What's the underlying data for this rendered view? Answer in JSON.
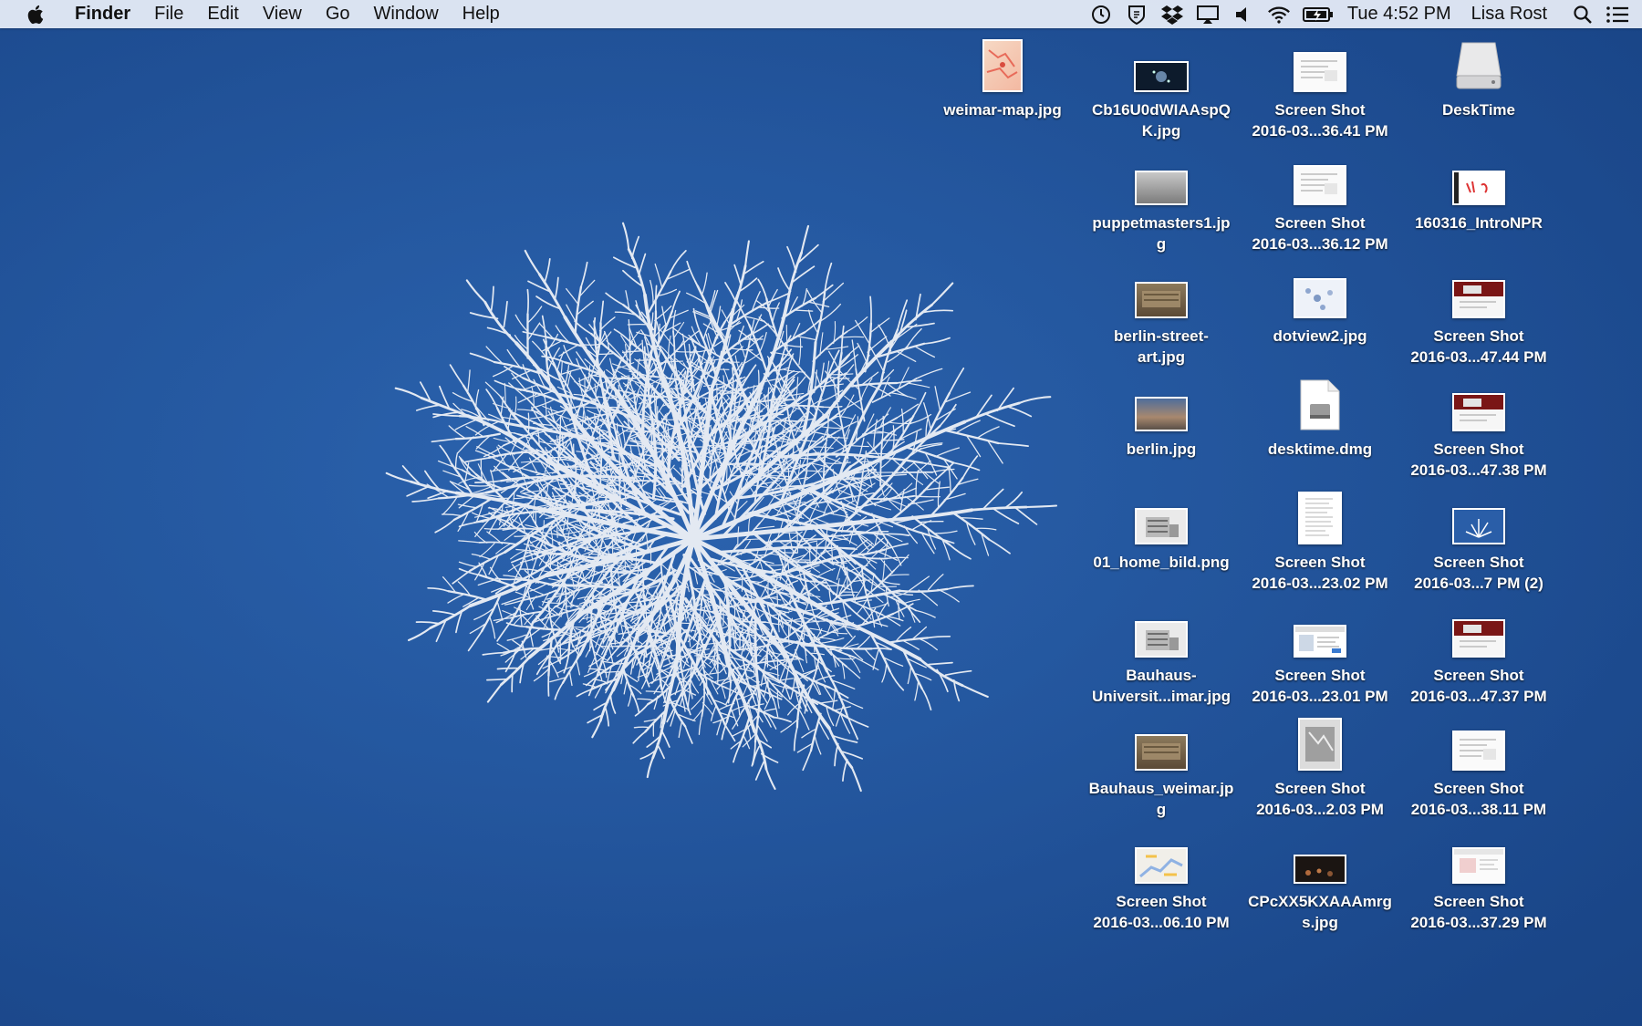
{
  "menubar": {
    "app_name": "Finder",
    "menus": [
      "File",
      "Edit",
      "View",
      "Go",
      "Window",
      "Help"
    ],
    "status_icons": [
      "time-machine-icon",
      "shield-icon",
      "dropbox-icon",
      "airplay-icon",
      "volume-icon",
      "wifi-icon",
      "battery-icon"
    ],
    "clock": "Tue 4:52 PM",
    "user": "Lisa Rost"
  },
  "desktop_icons": [
    {
      "label": "weimar-map.jpg",
      "kind": "map"
    },
    {
      "label": "Cb16U0dWIAAspQ\nK.jpg",
      "kind": "dark"
    },
    {
      "label": "Screen Shot\n2016-03...36.41 PM",
      "kind": "doc"
    },
    {
      "label": "DeskTime",
      "kind": "drive"
    },
    {
      "label": "puppetmasters1.jp\ng",
      "kind": "photo-gray"
    },
    {
      "label": "Screen Shot\n2016-03...36.12 PM",
      "kind": "doc"
    },
    {
      "label": "160316_IntroNPR",
      "kind": "film"
    },
    {
      "label": "berlin-street-\nart.jpg",
      "kind": "photo-brown"
    },
    {
      "label": "dotview2.jpg",
      "kind": "dots"
    },
    {
      "label": "Screen Shot\n2016-03...47.44 PM",
      "kind": "web-red"
    },
    {
      "label": "berlin.jpg",
      "kind": "city"
    },
    {
      "label": "desktime.dmg",
      "kind": "dmg"
    },
    {
      "label": "Screen Shot\n2016-03...47.38 PM",
      "kind": "web-red"
    },
    {
      "label": "01_home_bild.png",
      "kind": "building"
    },
    {
      "label": "Screen Shot\n2016-03...23.02 PM",
      "kind": "list"
    },
    {
      "label": "Screen Shot\n2016-03...7 PM (2)",
      "kind": "blue-plant"
    },
    {
      "label": "Bauhaus-\nUniversit...imar.jpg",
      "kind": "building"
    },
    {
      "label": "Screen Shot\n2016-03...23.01 PM",
      "kind": "window"
    },
    {
      "label": "Screen Shot\n2016-03...47.37 PM",
      "kind": "web-red"
    },
    {
      "label": "Bauhaus_weimar.jp\ng",
      "kind": "photo-brown"
    },
    {
      "label": "Screen Shot\n2016-03...2.03 PM",
      "kind": "gray-doc"
    },
    {
      "label": "Screen Shot\n2016-03...38.11 PM",
      "kind": "doc"
    },
    {
      "label": "Screen Shot\n2016-03...06.10 PM",
      "kind": "map-light"
    },
    {
      "label": "CPcXX5KXAAAmrg\ns.jpg",
      "kind": "dark-crowd"
    },
    {
      "label": "Screen Shot\n2016-03...37.29 PM",
      "kind": "web-light"
    }
  ]
}
